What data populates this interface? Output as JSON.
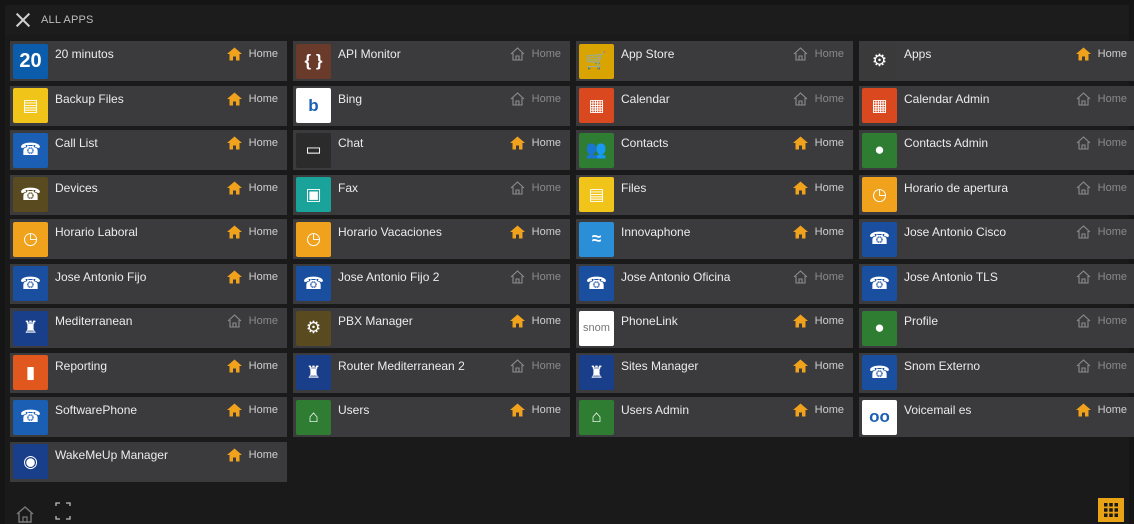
{
  "header": {
    "title": "ALL APPS"
  },
  "colors": {
    "home_active": "#f0a21c",
    "home_inactive": "#8c8c8c",
    "accent": "#e8a317"
  },
  "apps": [
    {
      "name": "20 minutos",
      "home": true,
      "icon": "twenty-minutos-icon",
      "bg": "#0b5cab",
      "glyph": "20"
    },
    {
      "name": "API Monitor",
      "home": false,
      "icon": "braces-icon",
      "bg": "#6a3a2a",
      "glyph": "{ }"
    },
    {
      "name": "App Store",
      "home": false,
      "icon": "cart-icon",
      "bg": "#d9a400",
      "glyph": "🛒"
    },
    {
      "name": "Apps",
      "home": true,
      "icon": "apps-gear-icon",
      "bg": "#3a3a3a",
      "glyph": "⚙"
    },
    {
      "name": "Backup Files",
      "home": true,
      "icon": "backup-files-icon",
      "bg": "#f0c419",
      "glyph": "▤"
    },
    {
      "name": "Bing",
      "home": false,
      "icon": "bing-icon",
      "bg": "#ffffff",
      "glyph": "b"
    },
    {
      "name": "Calendar",
      "home": false,
      "icon": "calendar-icon",
      "bg": "#d9481f",
      "glyph": "▦"
    },
    {
      "name": "Calendar Admin",
      "home": false,
      "icon": "calendar-admin-icon",
      "bg": "#d9481f",
      "glyph": "▦"
    },
    {
      "name": "Call List",
      "home": true,
      "icon": "call-list-icon",
      "bg": "#1a5fb4",
      "glyph": "☎"
    },
    {
      "name": "Chat",
      "home": true,
      "icon": "chat-icon",
      "bg": "#2b2b2b",
      "glyph": "▭"
    },
    {
      "name": "Contacts",
      "home": true,
      "icon": "contacts-icon",
      "bg": "#2e7d32",
      "glyph": "👥"
    },
    {
      "name": "Contacts Admin",
      "home": false,
      "icon": "contacts-admin-icon",
      "bg": "#2e7d32",
      "glyph": "●"
    },
    {
      "name": "Devices",
      "home": true,
      "icon": "devices-icon",
      "bg": "#5a4a20",
      "glyph": "☎"
    },
    {
      "name": "Fax",
      "home": false,
      "icon": "fax-icon",
      "bg": "#1aa39a",
      "glyph": "▣"
    },
    {
      "name": "Files",
      "home": true,
      "icon": "files-icon",
      "bg": "#f0c419",
      "glyph": "▤"
    },
    {
      "name": "Horario de apertura",
      "home": false,
      "icon": "clock-icon",
      "bg": "#f0a21c",
      "glyph": "◷"
    },
    {
      "name": "Horario Laboral",
      "home": true,
      "icon": "clock-icon",
      "bg": "#f0a21c",
      "glyph": "◷"
    },
    {
      "name": "Horario Vacaciones",
      "home": true,
      "icon": "clock-icon",
      "bg": "#f0a21c",
      "glyph": "◷"
    },
    {
      "name": "Innovaphone",
      "home": true,
      "icon": "innovaphone-icon",
      "bg": "#2a8fd6",
      "glyph": "≈"
    },
    {
      "name": "Jose Antonio Cisco",
      "home": false,
      "icon": "phone-keypad-icon",
      "bg": "#1a4fa0",
      "glyph": "☎"
    },
    {
      "name": "Jose Antonio Fijo",
      "home": true,
      "icon": "phone-keypad-icon",
      "bg": "#1a4fa0",
      "glyph": "☎"
    },
    {
      "name": "Jose Antonio Fijo 2",
      "home": false,
      "icon": "phone-keypad-icon",
      "bg": "#1a4fa0",
      "glyph": "☎"
    },
    {
      "name": "Jose Antonio Oficina",
      "home": false,
      "icon": "phone-keypad-icon",
      "bg": "#1a4fa0",
      "glyph": "☎"
    },
    {
      "name": "Jose Antonio TLS",
      "home": false,
      "icon": "phone-keypad-icon",
      "bg": "#1a4fa0",
      "glyph": "☎"
    },
    {
      "name": "Mediterranean",
      "home": false,
      "icon": "lighthouse-icon",
      "bg": "#1a3f8a",
      "glyph": "♜"
    },
    {
      "name": "PBX Manager",
      "home": true,
      "icon": "pbx-manager-icon",
      "bg": "#5a4a20",
      "glyph": "⚙"
    },
    {
      "name": "PhoneLink",
      "home": true,
      "icon": "snom-icon",
      "bg": "#ffffff",
      "glyph": "snom"
    },
    {
      "name": "Profile",
      "home": false,
      "icon": "profile-icon",
      "bg": "#2e7d32",
      "glyph": "●"
    },
    {
      "name": "Reporting",
      "home": true,
      "icon": "reporting-icon",
      "bg": "#e0581e",
      "glyph": "▮"
    },
    {
      "name": "Router Mediterranean 2",
      "home": false,
      "icon": "lighthouse-icon",
      "bg": "#1a3f8a",
      "glyph": "♜"
    },
    {
      "name": "Sites Manager",
      "home": true,
      "icon": "lighthouse-icon",
      "bg": "#1a3f8a",
      "glyph": "♜"
    },
    {
      "name": "Snom Externo",
      "home": false,
      "icon": "phone-keypad-icon",
      "bg": "#1a4fa0",
      "glyph": "☎"
    },
    {
      "name": "SoftwarePhone",
      "home": true,
      "icon": "phone-icon",
      "bg": "#1a5fb4",
      "glyph": "☎"
    },
    {
      "name": "Users",
      "home": true,
      "icon": "users-icon",
      "bg": "#2e7d32",
      "glyph": "⌂"
    },
    {
      "name": "Users Admin",
      "home": true,
      "icon": "users-admin-icon",
      "bg": "#2e7d32",
      "glyph": "⌂"
    },
    {
      "name": "Voicemail es",
      "home": true,
      "icon": "voicemail-icon",
      "bg": "#ffffff",
      "glyph": "oo"
    },
    {
      "name": "WakeMeUp Manager",
      "home": true,
      "icon": "wakemeup-icon",
      "bg": "#1a3f8a",
      "glyph": "◉"
    }
  ],
  "home_label": "Home"
}
